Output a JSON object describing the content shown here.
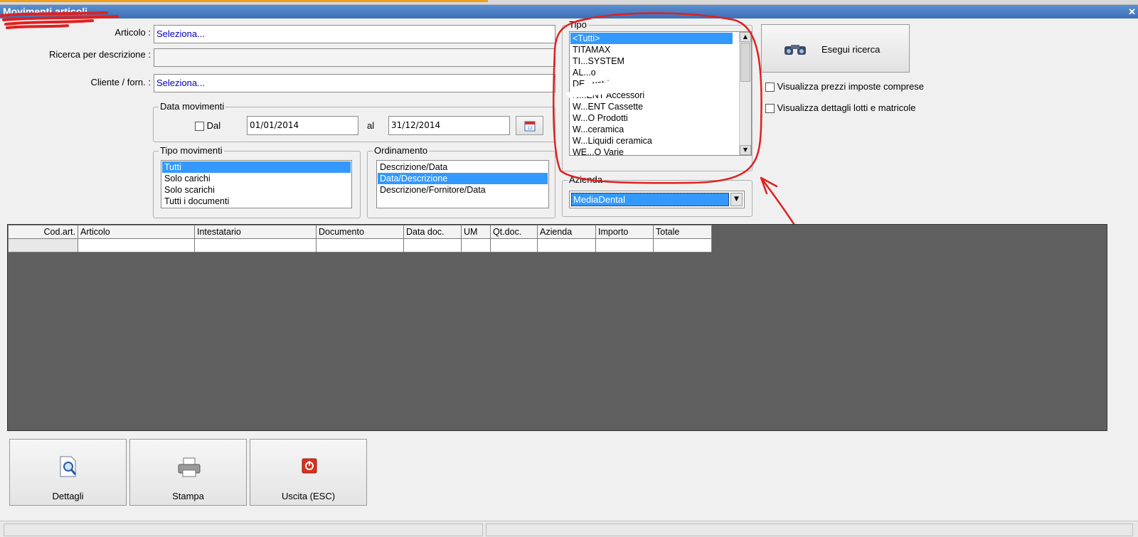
{
  "window": {
    "title": "Movimenti articoli"
  },
  "filters": {
    "articolo_label": "Articolo :",
    "articolo_value": "Seleziona...",
    "ricerca_label": "Ricerca per descrizione :",
    "ricerca_value": "",
    "cliente_label": "Cliente / forn. :",
    "cliente_value": "Seleziona..."
  },
  "data_movimenti": {
    "legend": "Data movimenti",
    "dal_label": "Dal",
    "dal_checked": false,
    "from": "01/01/2014",
    "al_label": "al",
    "to": "31/12/2014"
  },
  "tipo_movimenti": {
    "legend": "Tipo movimenti",
    "items": [
      "Tutti",
      "Solo carichi",
      "Solo scarichi",
      "Tutti i documenti"
    ],
    "selected": 0
  },
  "ordinamento": {
    "legend": "Ordinamento",
    "items": [
      "Descrizione/Data",
      "Data/Descrizione",
      "Descrizione/Fornitore/Data"
    ],
    "selected": 1
  },
  "tipo": {
    "legend": "Tipo",
    "items": [
      "<Tutti>",
      "TITAMAX",
      "TI...SYSTEM",
      "AL...o",
      "DE...ustri",
      "N...ENT Accessori",
      "W...ENT Cassette",
      "W...O Prodotti",
      "W...ceramica",
      "W...Liquidi ceramica",
      "WE...O Varie"
    ],
    "selected": 0
  },
  "azienda": {
    "legend": "Azienda",
    "value": "MediaDental"
  },
  "actions": {
    "search_label": "Esegui ricerca",
    "check_prezzi": "Visualizza prezzi imposte comprese",
    "check_lotti": "Visualizza dettagli lotti e matricole"
  },
  "table": {
    "columns": [
      "Cod.art.",
      "Articolo",
      "Intestatario",
      "Documento",
      "Data doc.",
      "UM",
      "Qt.doc.",
      "Azienda",
      "Importo",
      "Totale"
    ]
  },
  "footer": {
    "dettagli": "Dettagli",
    "stampa": "Stampa",
    "uscita": "Uscita (ESC)"
  },
  "icons": [
    "binoculars-icon",
    "calendar-icon",
    "magnifier-document-icon",
    "printer-icon",
    "exit-icon"
  ],
  "annotation_color": "#e02020"
}
